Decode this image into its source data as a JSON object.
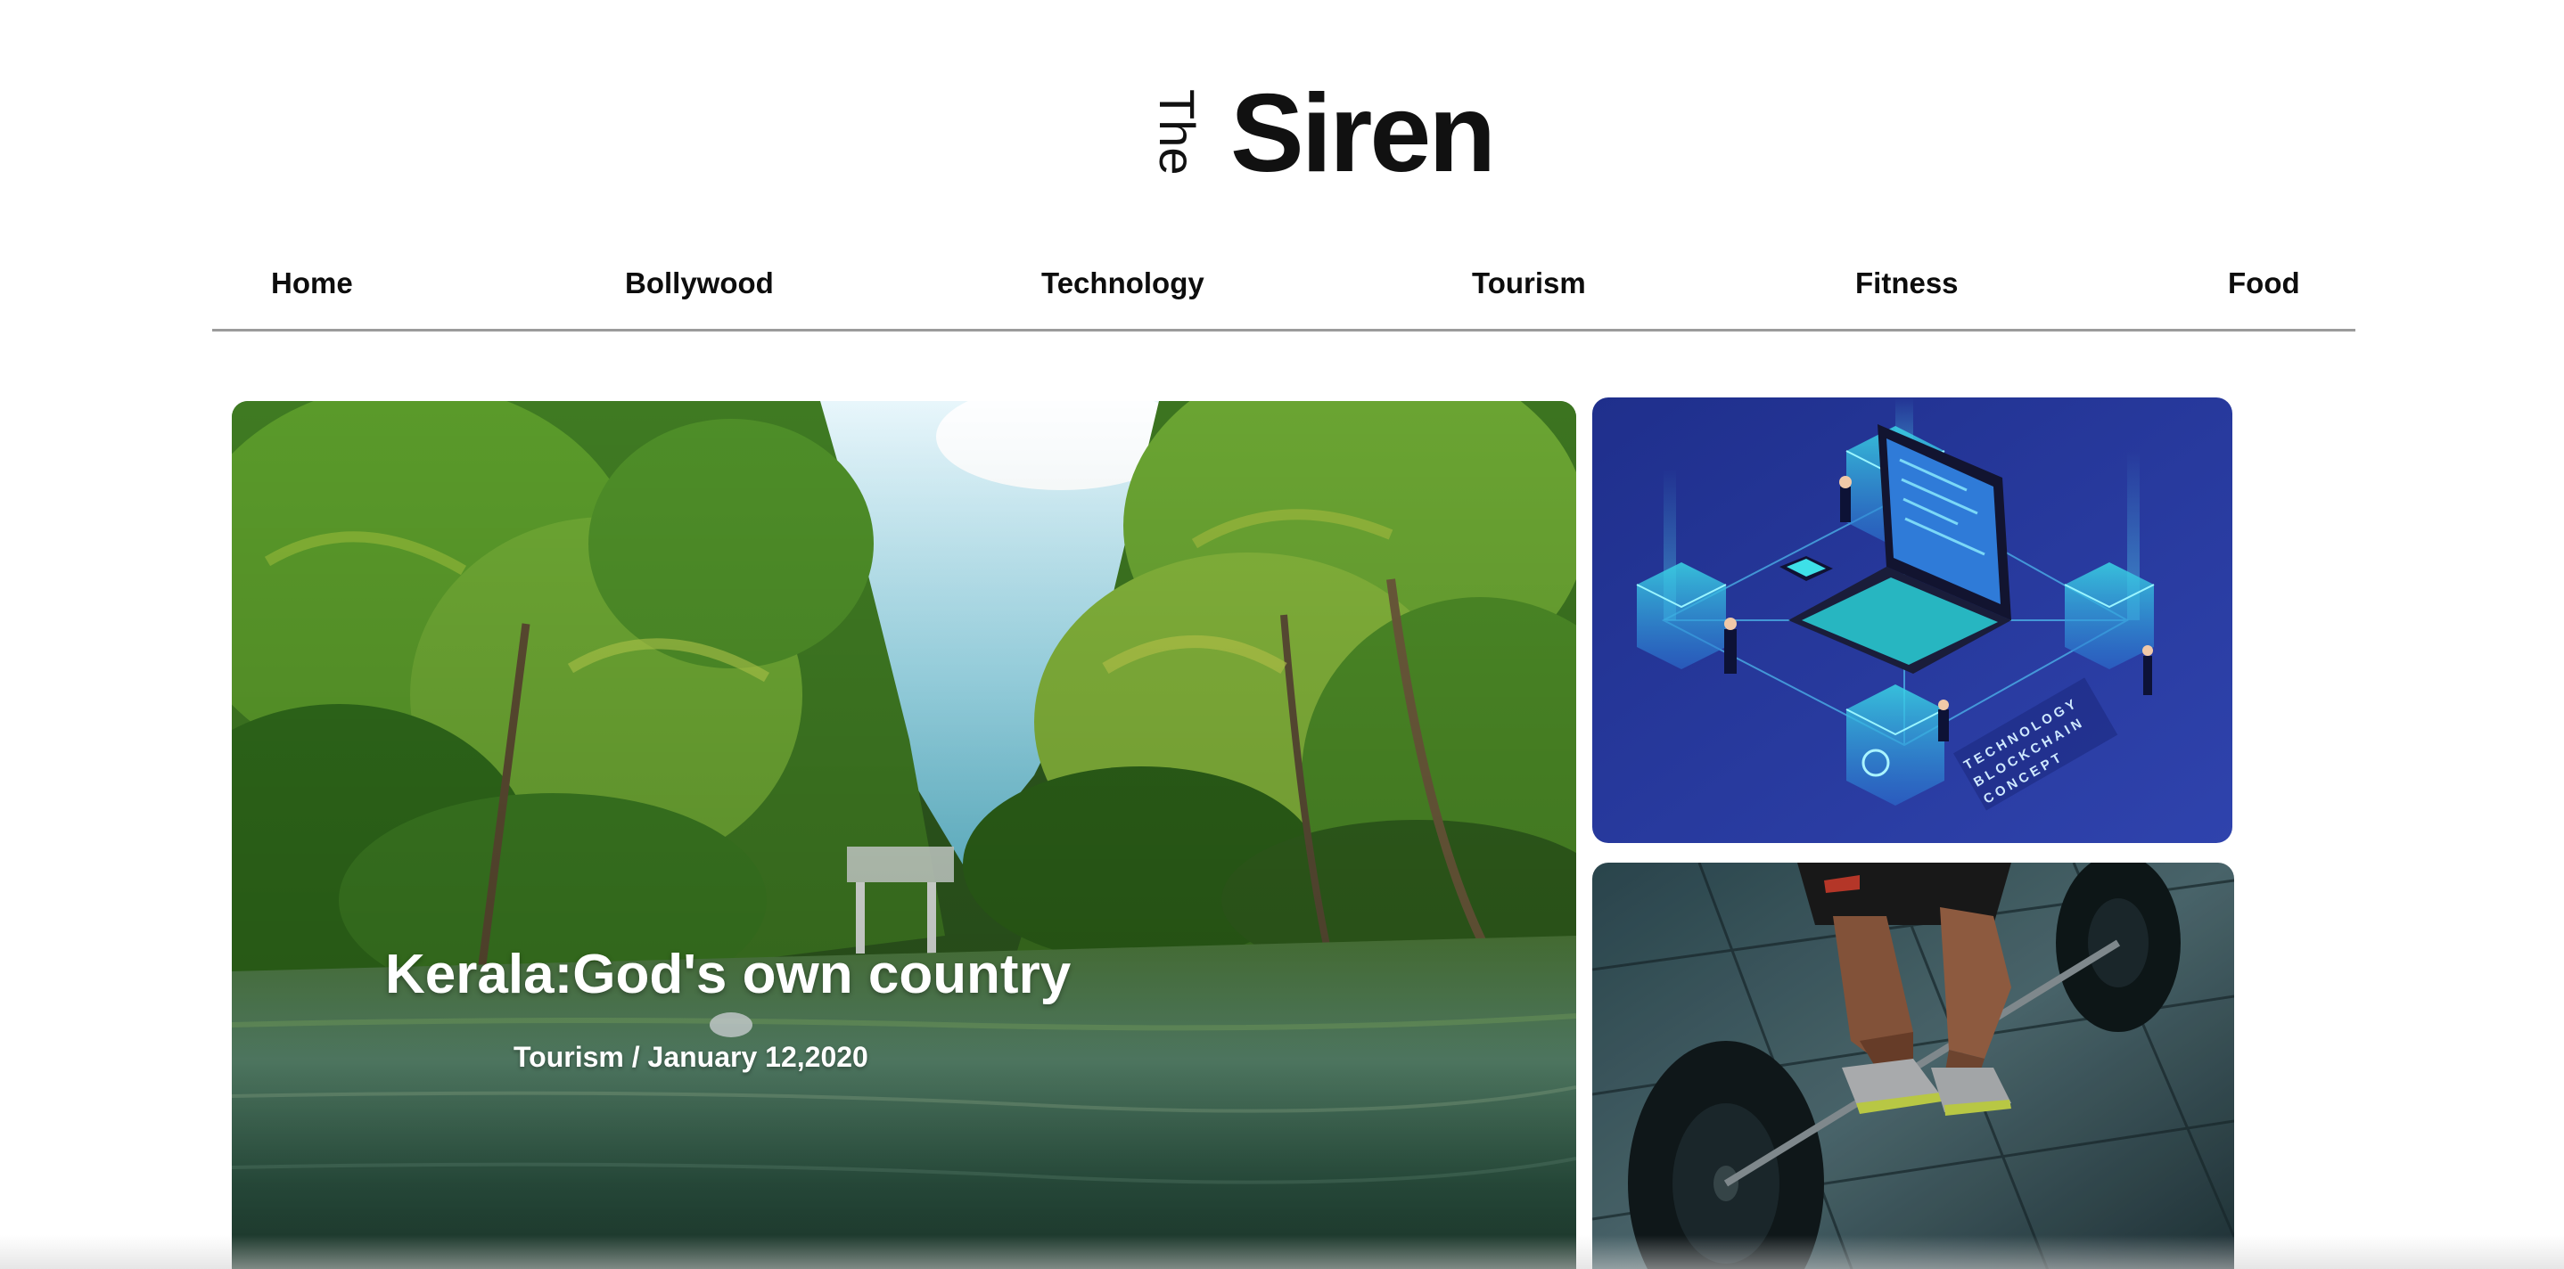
{
  "logo": {
    "the": "The",
    "name": "Siren"
  },
  "nav": {
    "items": [
      {
        "label": "Home"
      },
      {
        "label": "Bollywood"
      },
      {
        "label": "Technology"
      },
      {
        "label": "Tourism"
      },
      {
        "label": "Fitness"
      },
      {
        "label": "Food"
      }
    ]
  },
  "featured": {
    "title": "Kerala:God's own country",
    "meta": "Tourism / January 12,2020"
  },
  "tech_card": {
    "image_text": [
      "TECHNOLOGY",
      "BLOCKCHAIN",
      "CONCEPT"
    ]
  },
  "colors": {
    "nav_rule": "#9b9b9b",
    "text": "#0d0d0d",
    "tech_bg": "#2a3a9c",
    "accent_cyan": "#3fe0e8"
  }
}
